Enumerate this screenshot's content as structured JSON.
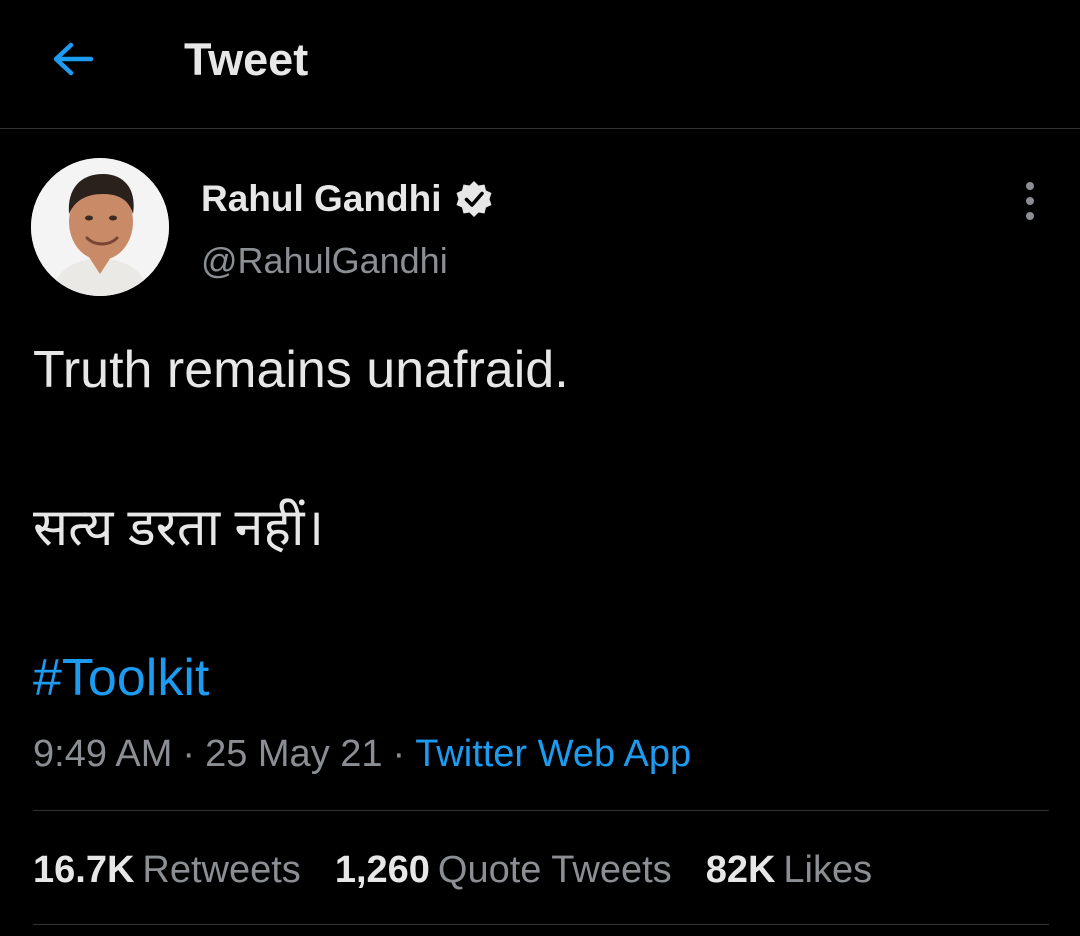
{
  "header": {
    "back_icon": "arrow-left-icon",
    "title": "Tweet"
  },
  "colors": {
    "background": "#000000",
    "accent": "#1d9bf0",
    "text_primary": "#e7e7e7",
    "text_secondary": "#8b8f94",
    "divider": "#2f3336"
  },
  "author": {
    "name": "Rahul Gandhi",
    "handle": "@RahulGandhi",
    "verified_icon": "verified-badge-icon",
    "avatar": "avatar-photo"
  },
  "more_icon": "more-vertical-icon",
  "tweet": {
    "line1": "Truth remains unafraid.",
    "line2": "सत्य डरता नहीं।",
    "hashtag": "#Toolkit"
  },
  "meta": {
    "time": "9:49 AM",
    "sep1": "·",
    "date": "25 May 21",
    "sep2": "·",
    "source": "Twitter Web App"
  },
  "stats": [
    {
      "value": "16.7K",
      "label": "Retweets"
    },
    {
      "value": "1,260",
      "label": "Quote Tweets"
    },
    {
      "value": "82K",
      "label": "Likes"
    }
  ]
}
